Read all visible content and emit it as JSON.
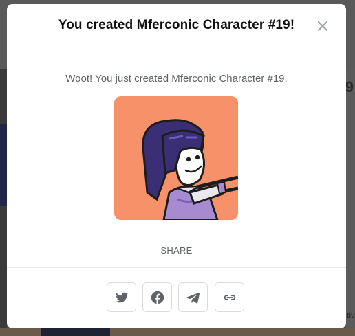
{
  "modal": {
    "title": "You created Mferconic Character #19!",
    "message": "Woot! You just created Mferconic Character #19.",
    "image_alt": "Mferconic Character #19",
    "share_label": "SHARE",
    "share_buttons": [
      {
        "name": "twitter",
        "icon": "twitter-icon"
      },
      {
        "name": "facebook",
        "icon": "facebook-icon"
      },
      {
        "name": "telegram",
        "icon": "telegram-icon"
      },
      {
        "name": "copy-link",
        "icon": "link-icon"
      }
    ],
    "close_icon": "close-icon"
  },
  "background": {
    "right_number": "9",
    "right_text": "tiv"
  },
  "colors": {
    "image_background": "#f7916a",
    "hair": "#3a2f74",
    "shirt": "#a78bd1",
    "icon": "#5f6368",
    "title": "#111111"
  }
}
